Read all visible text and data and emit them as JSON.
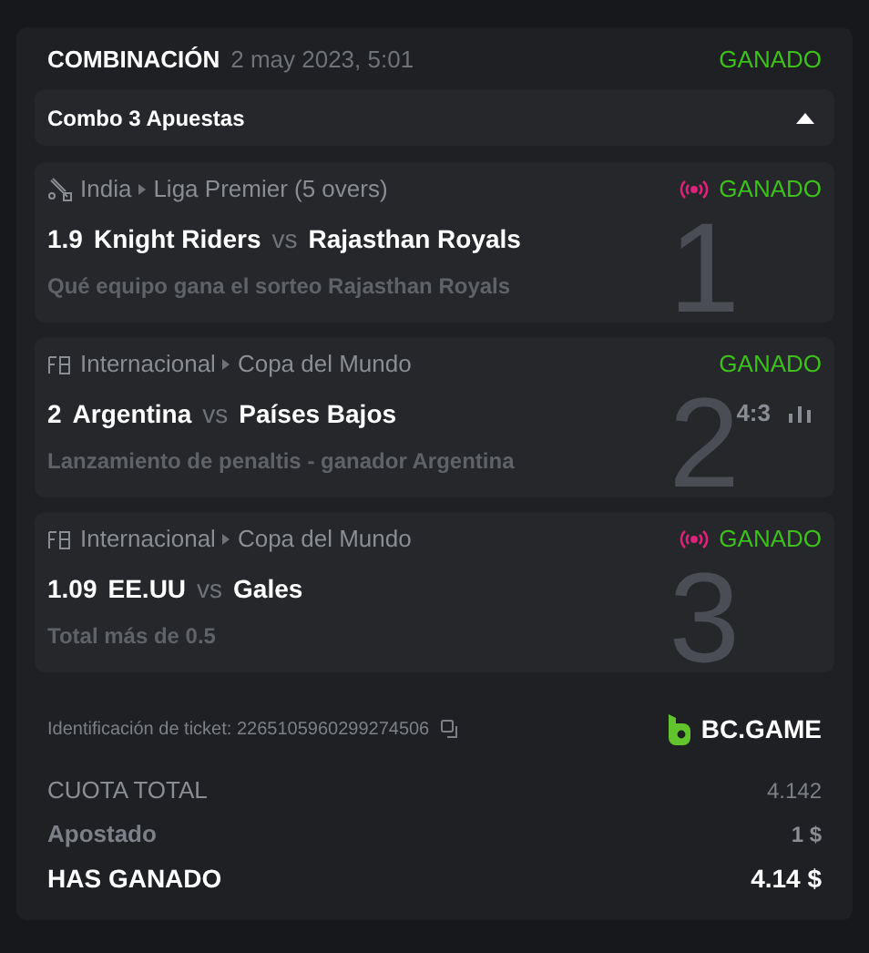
{
  "header": {
    "title": "COMBINACIÓN",
    "date": "2 may 2023, 5:01",
    "status": "GANADO"
  },
  "combo": {
    "label": "Combo 3 Apuestas",
    "expanded": true
  },
  "bets": [
    {
      "kind": "cricket",
      "country": "India",
      "league": "Liga Premier (5 overs)",
      "live": true,
      "status": "GANADO",
      "odds": "1.9",
      "team1": "Knight Riders",
      "vs": "vs",
      "team2": "Rajasthan Royals",
      "market": "Qué equipo gana el sorteo Rajasthan Royals",
      "number": "1"
    },
    {
      "kind": "football",
      "country": "Internacional",
      "league": "Copa del Mundo",
      "live": false,
      "status": "GANADO",
      "odds": "2",
      "team1": "Argentina",
      "vs": "vs",
      "team2": "Países Bajos",
      "market": "Lanzamiento de penaltis - ganador Argentina",
      "number": "2",
      "score": "4:3"
    },
    {
      "kind": "football",
      "country": "Internacional",
      "league": "Copa del Mundo",
      "live": true,
      "status": "GANADO",
      "odds": "1.09",
      "team1": "EE.UU",
      "vs": "vs",
      "team2": "Gales",
      "market": "Total más de 0.5",
      "number": "3"
    }
  ],
  "ticket": {
    "label": "Identificación de ticket:",
    "id": "2265105960299274506"
  },
  "brand": "BC.GAME",
  "totals": [
    {
      "kind": "plain",
      "label": "CUOTA TOTAL",
      "value": "4.142"
    },
    {
      "kind": "muted",
      "label": "Apostado",
      "value": "1 $"
    },
    {
      "kind": "strong",
      "label": "HAS GANADO",
      "value": "4.14 $"
    }
  ]
}
